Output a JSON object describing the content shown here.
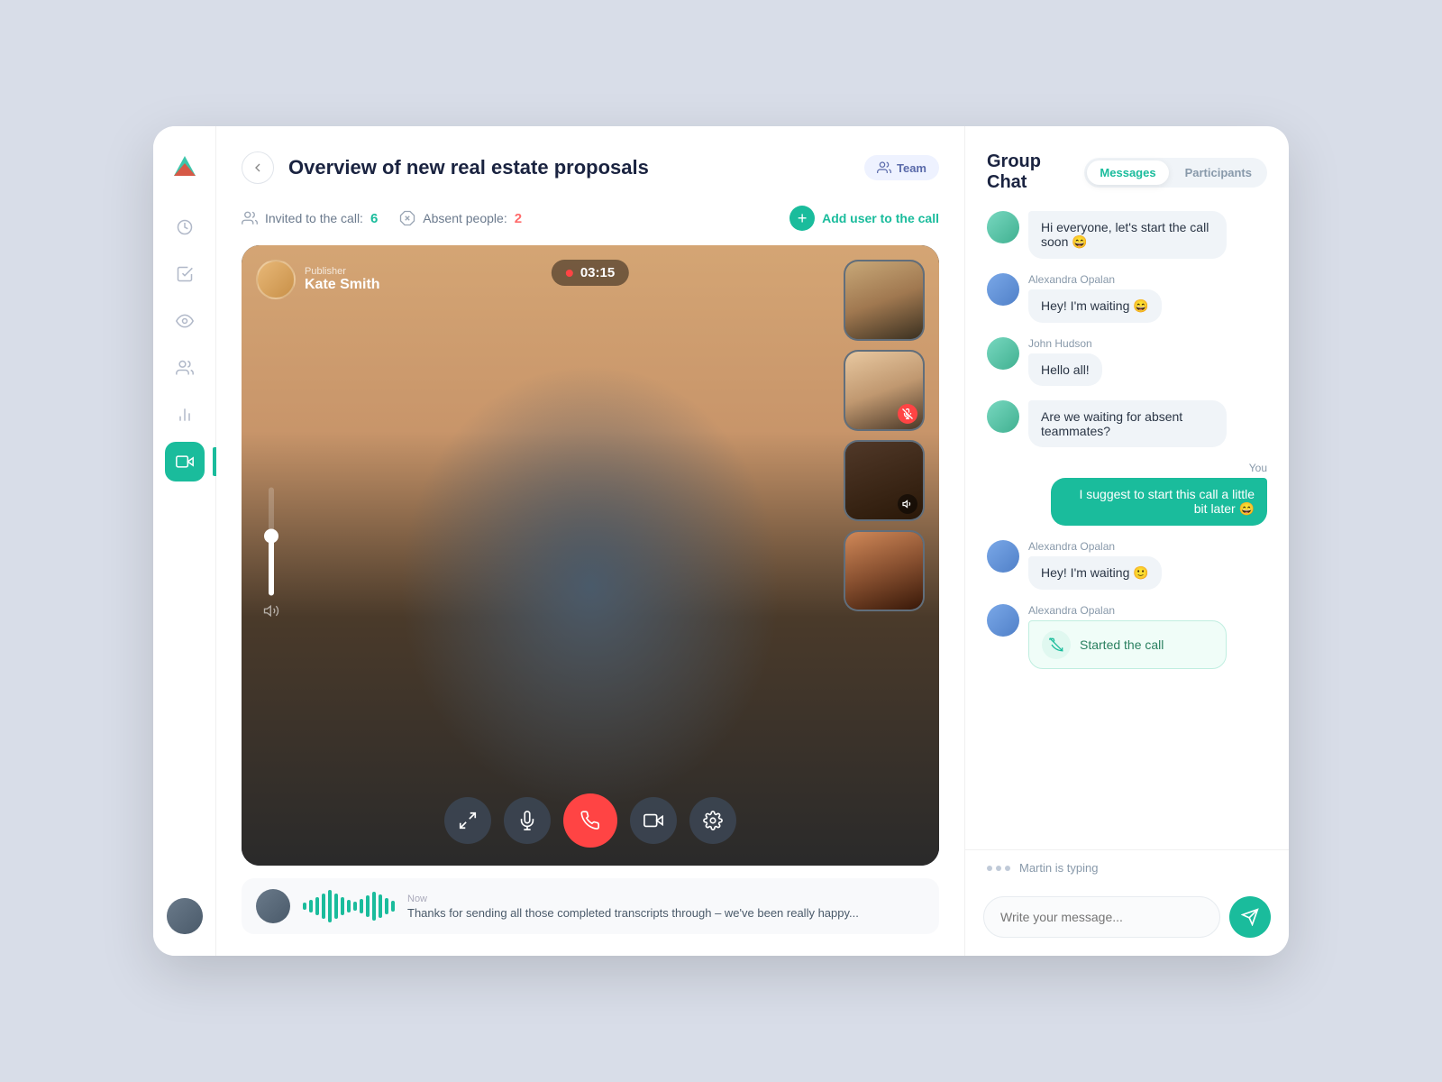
{
  "app": {
    "logo_title": "App Logo"
  },
  "header": {
    "back_label": "‹",
    "title": "Overview of new real estate proposals",
    "team_badge": "Team"
  },
  "stats": {
    "invited_label": "Invited to the call:",
    "invited_count": "6",
    "absent_label": "Absent people:",
    "absent_count": "2",
    "add_user_label": "Add user to the call"
  },
  "video": {
    "publisher_role": "Publisher",
    "publisher_name": "Kate Smith",
    "timer": "03:15",
    "thumbnails": [
      {
        "id": "thumb-1",
        "style": "thumb-person-1"
      },
      {
        "id": "thumb-2",
        "style": "thumb-person-2",
        "mic_off": true
      },
      {
        "id": "thumb-3",
        "style": "thumb-person-3",
        "sound": true
      },
      {
        "id": "thumb-4",
        "style": "thumb-person-4"
      }
    ]
  },
  "controls": [
    {
      "id": "expand",
      "label": "Expand"
    },
    {
      "id": "mute",
      "label": "Mute"
    },
    {
      "id": "end-call",
      "label": "End Call"
    },
    {
      "id": "camera",
      "label": "Camera"
    },
    {
      "id": "settings",
      "label": "Settings"
    }
  ],
  "transcript": {
    "time": "Now",
    "message": "Thanks for sending all those completed transcripts through – we've been really happy..."
  },
  "chat": {
    "title": "Group Chat",
    "tab_messages": "Messages",
    "tab_participants": "Participants",
    "messages": [
      {
        "id": "msg-1",
        "sender": "",
        "text": "Hi everyone, let's start the call soon 😄",
        "type": "incoming",
        "avatar_class": "av-teal"
      },
      {
        "id": "msg-2",
        "sender": "Alexandra Opalan",
        "text": "Hey! I'm waiting 😄",
        "type": "incoming",
        "avatar_class": "av-blue"
      },
      {
        "id": "msg-3",
        "sender": "John Hudson",
        "text": "Hello all!",
        "type": "incoming",
        "avatar_class": "av-teal"
      },
      {
        "id": "msg-4",
        "sender": "",
        "text": "Are we waiting for absent teammates?",
        "type": "incoming",
        "avatar_class": "av-teal"
      },
      {
        "id": "msg-5",
        "sender": "You",
        "text": "I suggest to start this call a little bit later 😄",
        "type": "self"
      },
      {
        "id": "msg-6",
        "sender": "Alexandra Opalan",
        "text": "Hey! I'm waiting 🙂",
        "type": "incoming",
        "avatar_class": "av-blue"
      },
      {
        "id": "msg-7",
        "sender": "Alexandra Opalan",
        "text": "Started the call",
        "type": "action",
        "avatar_class": "av-blue"
      }
    ],
    "typing_name": "Martin",
    "typing_text": "Martin is typing",
    "input_placeholder": "Write your message...",
    "send_label": "Send"
  },
  "sidebar": {
    "nav_items": [
      {
        "id": "clock",
        "label": "Recent"
      },
      {
        "id": "check",
        "label": "Tasks"
      },
      {
        "id": "eye",
        "label": "Watch"
      },
      {
        "id": "users",
        "label": "People"
      },
      {
        "id": "chart",
        "label": "Analytics"
      },
      {
        "id": "video",
        "label": "Video Call",
        "active": true
      }
    ]
  },
  "waveform_bars": [
    8,
    14,
    20,
    28,
    36,
    28,
    20,
    14,
    10,
    16,
    24,
    32,
    26,
    18,
    12
  ]
}
